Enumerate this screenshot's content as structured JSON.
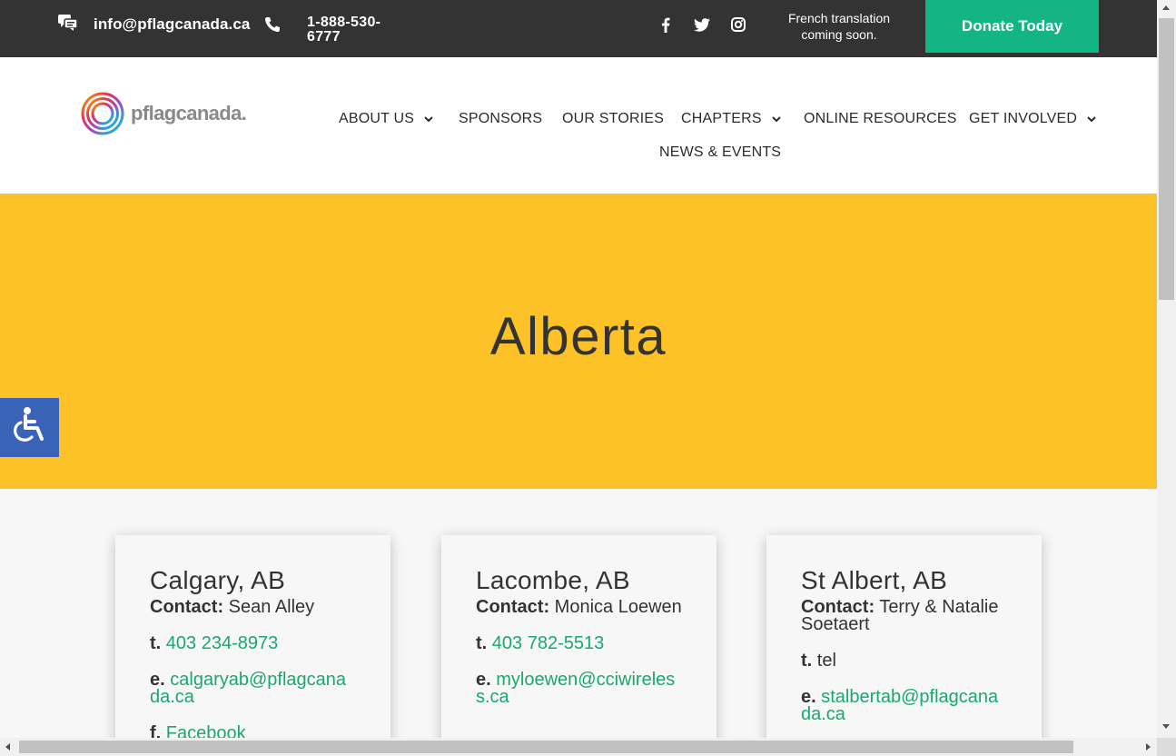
{
  "topbar": {
    "email": "info@pflagcanada.ca",
    "phone": "1-888-530-6777",
    "french_note": "French translation coming soon.",
    "donate_label": "Donate Today",
    "social_icons": [
      "facebook-icon",
      "twitter-icon",
      "instagram-icon"
    ]
  },
  "header": {
    "logo_text_a": "pflag",
    "logo_text_b": "canada.",
    "nav": [
      {
        "label": "ABOUT US",
        "dropdown": true
      },
      {
        "label": "SPONSORS",
        "dropdown": false
      },
      {
        "label": "OUR STORIES",
        "dropdown": false
      },
      {
        "label": "CHAPTERS",
        "dropdown": true
      },
      {
        "label": "ONLINE RESOURCES",
        "dropdown": false
      },
      {
        "label": "GET INVOLVED",
        "dropdown": true
      },
      {
        "label": "NEWS & EVENTS",
        "dropdown": false
      }
    ]
  },
  "hero": {
    "title": "Alberta"
  },
  "chapters": [
    {
      "city": "Calgary, AB",
      "contact_label": "Contact:",
      "contact": "Sean Alley",
      "phone_label": "t.",
      "phone": "403 234-8973",
      "email_label": "e.",
      "email": "calgaryab@pflagcanada.ca",
      "facebook_label": "f.",
      "facebook": "Facebook"
    },
    {
      "city": "Lacombe, AB",
      "contact_label": "Contact:",
      "contact": "Monica Loewen",
      "phone_label": "t.",
      "phone": "403 782-5513",
      "email_label": "e.",
      "email": "myloewen@cciwireless.ca"
    },
    {
      "city": "St Albert, AB",
      "contact_label": "Contact:",
      "contact": "Terry & Natalie Soetaert",
      "phone_label": "t.",
      "phone": "tel",
      "email_label": "e.",
      "email": "stalbertab@pflagcanada.ca"
    }
  ],
  "colors": {
    "topbar_bg": "#333333",
    "donate_bg": "#13b585",
    "hero_bg": "#fcc227",
    "link": "#1aa86e",
    "a11y_bg": "#3b63b8"
  }
}
